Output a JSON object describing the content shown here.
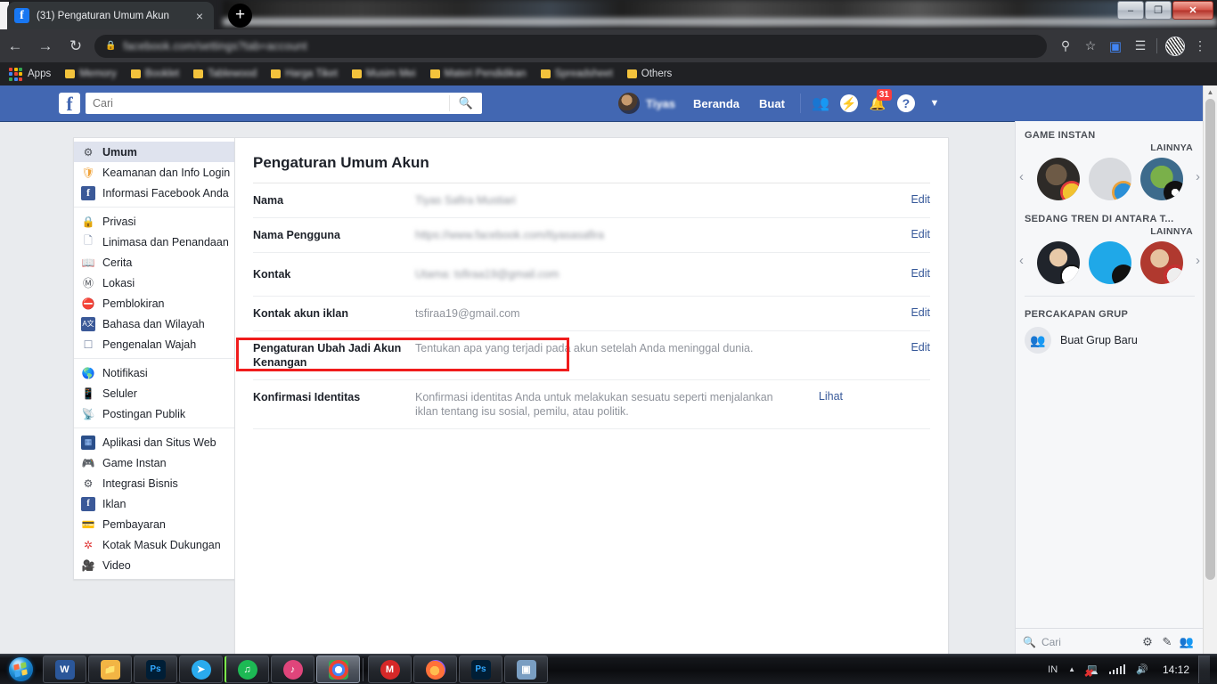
{
  "browser": {
    "tab": {
      "title": "(31) Pengaturan Umum Akun",
      "favicon": "facebook-icon",
      "close": "×"
    },
    "newtab_label": "+",
    "window_controls": {
      "minimize": "–",
      "maximize": "❐",
      "close": "✕"
    },
    "nav": {
      "back": "←",
      "forward": "→",
      "reload": "↻"
    },
    "omnibox": {
      "lock": "🔒",
      "url": "facebook.com/settings?tab=account"
    },
    "toolbar_icons": [
      "key-icon",
      "star-icon",
      "translate-extension-icon",
      "reading-list-icon",
      "profile-avatar",
      "kebab-menu-icon"
    ],
    "bookmarks": {
      "apps_label": "Apps",
      "items": [
        {
          "label": "Memory",
          "blurred": true
        },
        {
          "label": "Booklet",
          "blurred": true
        },
        {
          "label": "Tablewood",
          "blurred": true
        },
        {
          "label": "Harga Tiket",
          "blurred": true
        },
        {
          "label": "Musim Mei",
          "blurred": true
        },
        {
          "label": "Materi Pendidikan",
          "blurred": true
        },
        {
          "label": "Spreadsheet",
          "blurred": true
        },
        {
          "label": "Others",
          "blurred": false
        }
      ]
    }
  },
  "facebook": {
    "logo": "f",
    "search": {
      "placeholder": "Cari",
      "value": "",
      "icon": "search-icon"
    },
    "profile_name": "Tiyas",
    "links": [
      "Beranda",
      "Buat"
    ],
    "icons": [
      {
        "name": "friend-requests-icon",
        "glyph": "👥",
        "badge": null
      },
      {
        "name": "messenger-icon",
        "glyph": "⚡",
        "badge": null
      },
      {
        "name": "notifications-icon",
        "glyph": "🔔",
        "badge": "31"
      },
      {
        "name": "help-icon",
        "glyph": "?",
        "badge": null
      },
      {
        "name": "account-menu-icon",
        "glyph": "▼",
        "badge": null
      }
    ]
  },
  "sidebar": {
    "groups": [
      {
        "items": [
          {
            "label": "Umum",
            "icon": "gear-icon",
            "selected": true
          },
          {
            "label": "Keamanan dan Info Login",
            "icon": "shield-icon",
            "selected": false
          },
          {
            "label": "Informasi Facebook Anda",
            "icon": "facebook-icon",
            "selected": false
          }
        ]
      },
      {
        "items": [
          {
            "label": "Privasi",
            "icon": "lock-icon",
            "selected": false
          },
          {
            "label": "Linimasa dan Penandaan",
            "icon": "timeline-icon",
            "selected": false
          },
          {
            "label": "Cerita",
            "icon": "book-icon",
            "selected": false
          },
          {
            "label": "Lokasi",
            "icon": "location-icon",
            "selected": false
          },
          {
            "label": "Pemblokiran",
            "icon": "block-icon",
            "selected": false
          },
          {
            "label": "Bahasa dan Wilayah",
            "icon": "language-icon",
            "selected": false
          },
          {
            "label": "Pengenalan Wajah",
            "icon": "face-recognition-icon",
            "selected": false
          }
        ]
      },
      {
        "items": [
          {
            "label": "Notifikasi",
            "icon": "globe-icon",
            "selected": false
          },
          {
            "label": "Seluler",
            "icon": "mobile-icon",
            "selected": false
          },
          {
            "label": "Postingan Publik",
            "icon": "rss-icon",
            "selected": false
          }
        ]
      },
      {
        "items": [
          {
            "label": "Aplikasi dan Situs Web",
            "icon": "apps-icon",
            "selected": false
          },
          {
            "label": "Game Instan",
            "icon": "gamepad-icon",
            "selected": false
          },
          {
            "label": "Integrasi Bisnis",
            "icon": "business-icon",
            "selected": false
          },
          {
            "label": "Iklan",
            "icon": "ads-icon",
            "selected": false
          },
          {
            "label": "Pembayaran",
            "icon": "payment-icon",
            "selected": false
          },
          {
            "label": "Kotak Masuk Dukungan",
            "icon": "support-icon",
            "selected": false
          },
          {
            "label": "Video",
            "icon": "video-icon",
            "selected": false
          }
        ]
      }
    ]
  },
  "main": {
    "title": "Pengaturan Umum Akun",
    "rows": [
      {
        "key": "Nama",
        "value": "Tiyas Safira Mustiari",
        "blurred": true,
        "action": "Edit"
      },
      {
        "key": "Nama Pengguna",
        "value": "https://www.facebook.com/tiyasasafira",
        "blurred": true,
        "action": "Edit"
      },
      {
        "key": "Kontak",
        "value": "Utama: tsfiraa19@gmail.com",
        "blurred": true,
        "action": "Edit",
        "highlighted": true
      },
      {
        "key": "Kontak akun iklan",
        "value": "tsfiraa19@gmail.com",
        "blurred": false,
        "action": "Edit"
      },
      {
        "key": "Pengaturan Ubah Jadi Akun Kenangan",
        "value": "Tentukan apa yang terjadi pada akun setelah Anda meninggal dunia.",
        "blurred": false,
        "action": "Edit"
      },
      {
        "key": "Konfirmasi Identitas",
        "value": "Konfirmasi identitas Anda untuk melakukan sesuatu seperti menjalankan iklan tentang isu sosial, pemilu, atau politik.",
        "blurred": false,
        "action": "Lihat"
      }
    ],
    "highlight_color": "#f01c1c"
  },
  "right_sidebar": {
    "sections": [
      {
        "heading": "GAME INSTAN",
        "more": "LAINNYA"
      },
      {
        "heading": "SEDANG TREN DI ANTARA T...",
        "more": "LAINNYA"
      }
    ],
    "group_heading": "PERCAKAPAN GRUP",
    "create_group": "Buat Grup Baru",
    "footer": {
      "search_placeholder": "Cari",
      "icons": [
        "gear-icon",
        "compose-icon",
        "group-chat-icon",
        "chevron-down-icon"
      ]
    },
    "arrows": {
      "prev": "‹",
      "next": "›"
    }
  },
  "taskbar": {
    "start": "windows-start-orb",
    "items": [
      {
        "name": "word-icon",
        "glyph": "W",
        "color": "#2b579a",
        "active": false
      },
      {
        "name": "file-explorer-icon",
        "glyph": "📁",
        "color": "#f2b544",
        "active": false
      },
      {
        "name": "photoshop-icon",
        "glyph": "Ps",
        "color": "#001e36",
        "active": false
      },
      {
        "name": "telegram-icon",
        "glyph": "➤",
        "color": "#2aabee",
        "active": false
      },
      {
        "name": "spotify-icon",
        "glyph": "♫",
        "color": "#1db954",
        "active": false
      },
      {
        "name": "music-player-icon",
        "glyph": "♪",
        "color": "#e0457b",
        "active": false
      },
      {
        "name": "chrome-icon",
        "glyph": "◉",
        "color": "#4285f4",
        "active": true
      },
      {
        "name": "media-icon",
        "glyph": "M",
        "color": "#d62828",
        "active": false
      },
      {
        "name": "firefox-icon",
        "glyph": "🔥",
        "color": "#ff7139",
        "active": false
      },
      {
        "name": "photoshop-2-icon",
        "glyph": "Ps",
        "color": "#001e36",
        "active": false
      },
      {
        "name": "scanner-icon",
        "glyph": "❐",
        "color": "#7a9ec2",
        "active": false
      }
    ],
    "tray": {
      "language": "IN",
      "show_hidden": "▲",
      "network": "network-disconnected-icon",
      "signal": "signal-bars-icon",
      "volume": "volume-icon",
      "clock": "14:12"
    }
  }
}
